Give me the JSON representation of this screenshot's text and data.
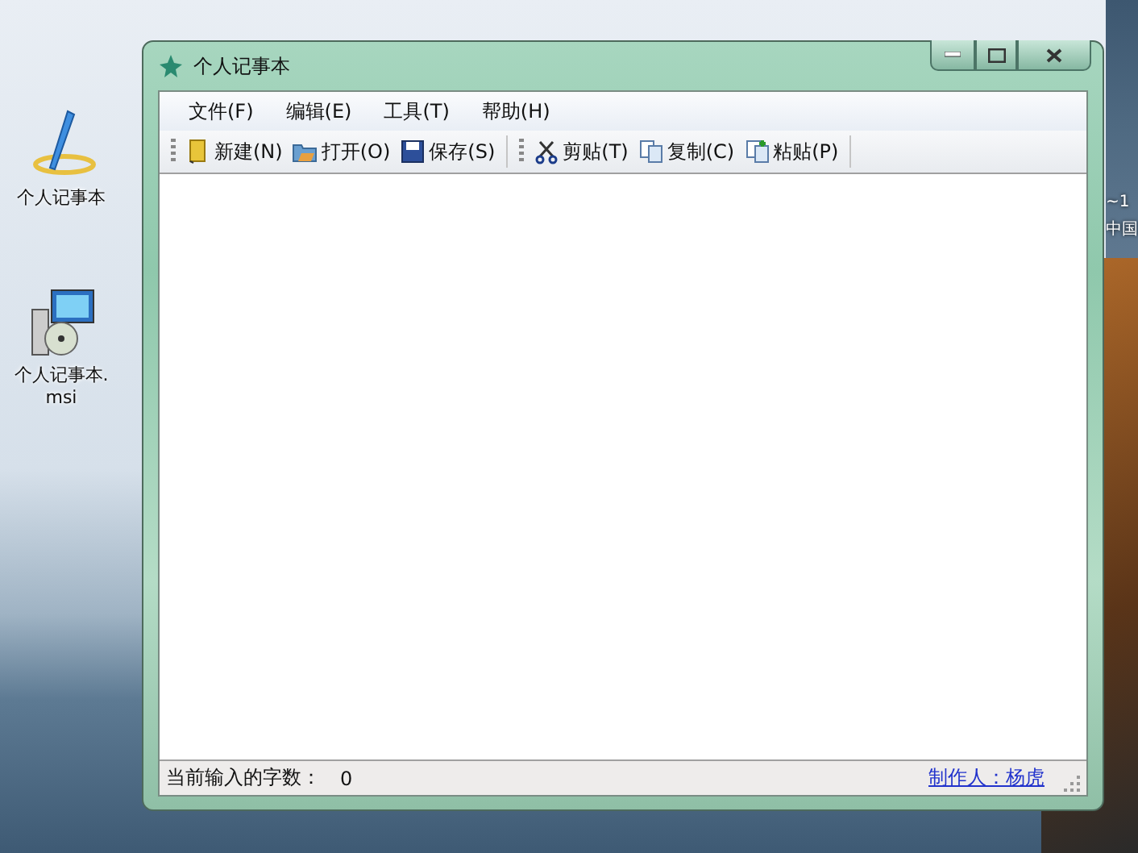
{
  "desktop": {
    "icons": [
      {
        "kind": "pen",
        "label": "个人记事本"
      },
      {
        "kind": "installer",
        "label": "个人记事本.msi"
      }
    ]
  },
  "gadget": {
    "temperature": "~1",
    "location": "中国"
  },
  "window": {
    "title": "个人记事本"
  },
  "menu": [
    "文件(F)",
    "编辑(E)",
    "工具(T)",
    "帮助(H)"
  ],
  "toolbar": [
    [
      {
        "kind": "new",
        "label": "新建(N)"
      },
      {
        "kind": "open",
        "label": "打开(O)"
      },
      {
        "kind": "save",
        "label": "保存(S)"
      }
    ],
    [
      {
        "kind": "cut",
        "label": "剪贴(T)"
      },
      {
        "kind": "copy",
        "label": "复制(C)"
      },
      {
        "kind": "paste",
        "label": "粘贴(P)"
      }
    ]
  ],
  "status_bar": {
    "label": "当前输入的字数：",
    "count": "0",
    "author_link": "制作人：杨虎"
  }
}
